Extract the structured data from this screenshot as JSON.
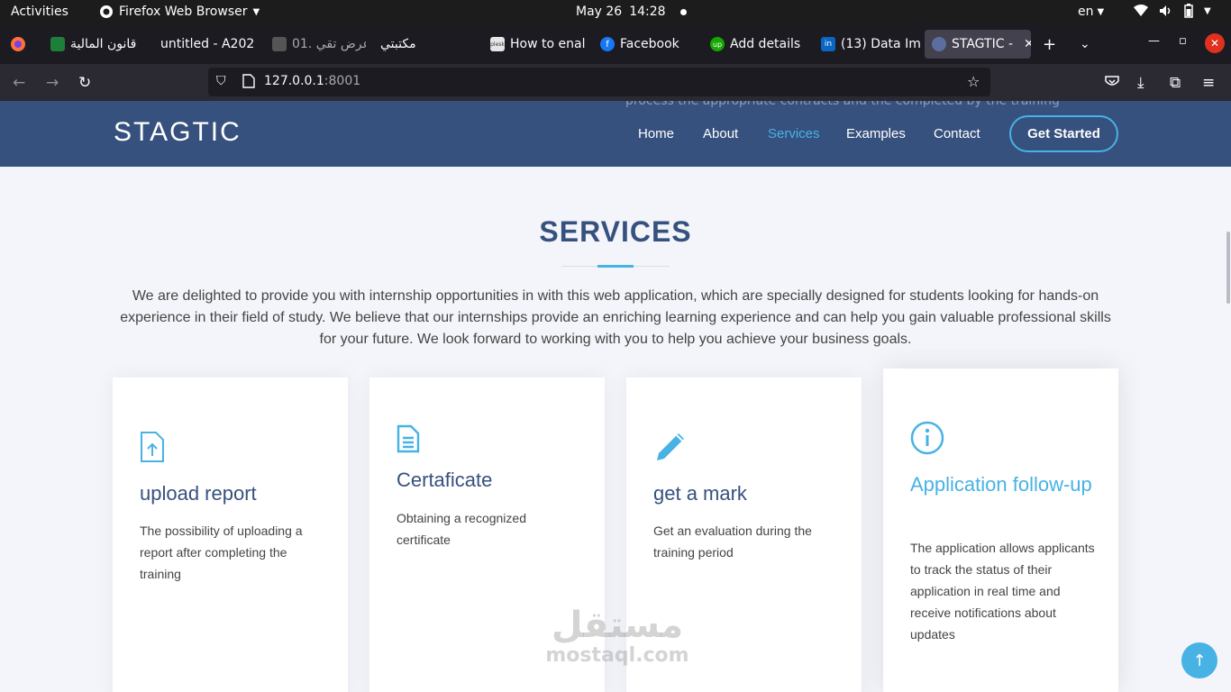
{
  "system_bar": {
    "activities": "Activities",
    "app_name": "Firefox Web Browser",
    "date": "May 26",
    "time": "14:28",
    "language": "en"
  },
  "tabs": [
    {
      "label": "قانون المالية"
    },
    {
      "label": "untitled - A202"
    },
    {
      "label": "01. عرض تقي"
    },
    {
      "label": "مكتبتي"
    },
    {
      "label": "How to enal"
    },
    {
      "label": "Facebook"
    },
    {
      "label": "Add details"
    },
    {
      "label": "(13) Data Im"
    },
    {
      "label": "STAGTIC -"
    }
  ],
  "url": {
    "host": "127.0.0.1",
    "port": ":8001"
  },
  "site": {
    "logo": "STAGTIC",
    "nav": [
      "Home",
      "About",
      "Services",
      "Examples",
      "Contact"
    ],
    "cta": "Get Started",
    "header_ghost_text": "process the appropriate contracts and the completed by the training"
  },
  "services": {
    "title": "SERVICES",
    "description": "We are delighted to provide you with internship opportunities in with this web application, which are specially designed for students looking for hands-on experience in their field of study. We believe that our internships provide an enriching learning experience and can help you gain valuable professional skills for your future. We look forward to working with you to help you achieve your business goals.",
    "cards": [
      {
        "title": "upload report",
        "text": "The possibility of uploading a report after completing the training",
        "icon": "file-upload-icon"
      },
      {
        "title": "Certaficate",
        "text": "Obtaining a recognized certificate",
        "icon": "document-icon"
      },
      {
        "title": "get a mark",
        "text": "Get an evaluation during the training period",
        "icon": "pencil-icon"
      },
      {
        "title": "Application follow-up",
        "text": "The application allows applicants to track the status of their application in real time and receive notifications about updates",
        "icon": "info-icon"
      }
    ]
  },
  "watermark": {
    "arabic": "مستقل",
    "latin": "mostaql.com"
  },
  "colors": {
    "brand": "#37517e",
    "accent": "#47b2e4"
  }
}
